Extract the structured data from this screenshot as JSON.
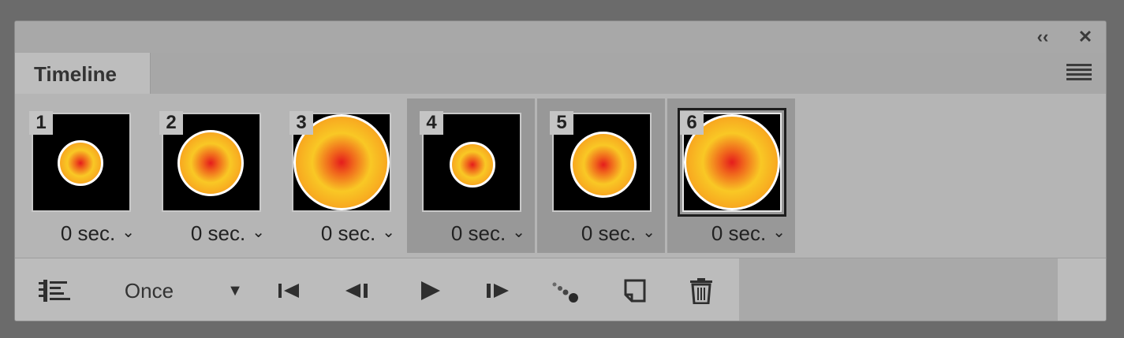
{
  "panel": {
    "collapse_glyph": "‹‹",
    "close_glyph": "✕",
    "tab_label": "Timeline",
    "menu_icon": "panel-menu-icon"
  },
  "frames": [
    {
      "number": "1",
      "delay": "0 sec.",
      "selected": false
    },
    {
      "number": "2",
      "delay": "0 sec.",
      "selected": false
    },
    {
      "number": "3",
      "delay": "0 sec.",
      "selected": false
    },
    {
      "number": "4",
      "delay": "0 sec.",
      "selected": true
    },
    {
      "number": "5",
      "delay": "0 sec.",
      "selected": true
    },
    {
      "number": "6",
      "delay": "0 sec.",
      "selected": true
    }
  ],
  "controls": {
    "loop_value": "Once",
    "dropdown_glyph": "▼",
    "first_frame_glyph": "⏮",
    "prev_frame_glyph": "◀▮",
    "play_glyph": "▶",
    "next_frame_glyph": "▮▶",
    "tween_icon": "tween-icon",
    "duplicate_icon": "duplicate-frame-icon",
    "delete_icon": "trash-icon"
  },
  "colors": {
    "frame_background": "#000000",
    "circle_center": "#e51c1c",
    "circle_mid": "#f9c825",
    "selected_frame_bg": "#989898"
  }
}
